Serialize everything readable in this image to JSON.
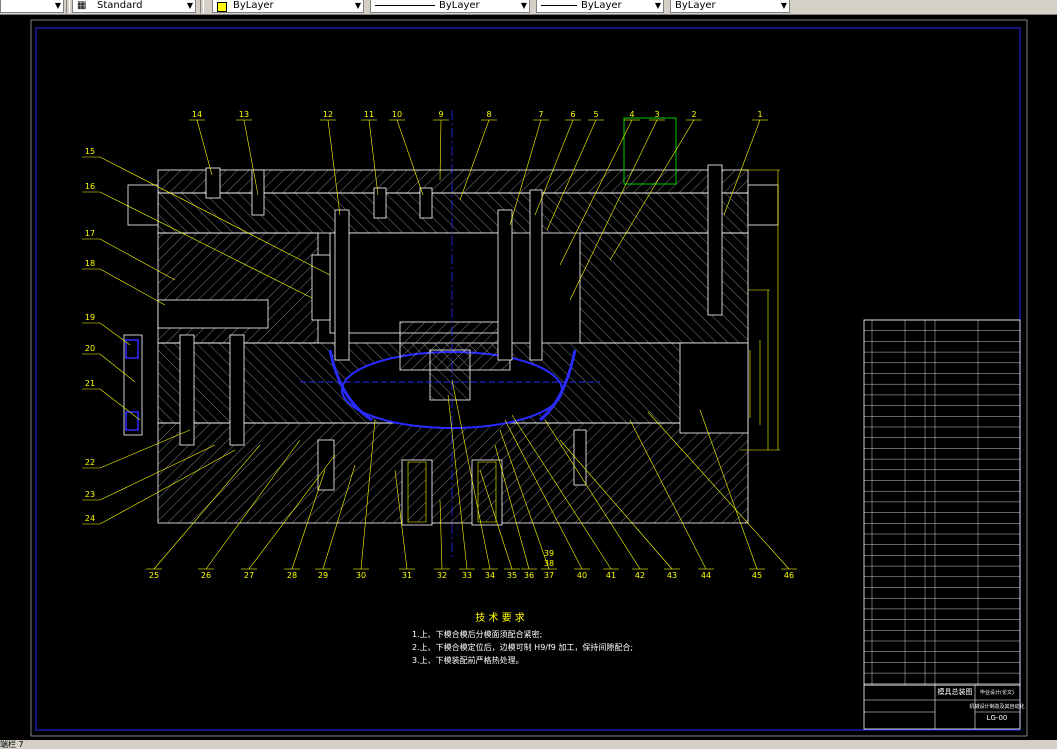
{
  "toolbar": {
    "linetype_label": "Standard",
    "color_label": "ByLayer",
    "line1_label": "ByLayer",
    "line2_label": "ByLayer",
    "line3_label": "ByLayer"
  },
  "drawing": {
    "callouts_top": [
      "14",
      "13",
      "12",
      "11",
      "10",
      "9",
      "8",
      "7",
      "6",
      "5",
      "4",
      "3",
      "2",
      "1"
    ],
    "callouts_left": [
      "15",
      "16",
      "17",
      "18",
      "19",
      "20",
      "21",
      "22",
      "23",
      "24"
    ],
    "callouts_bottom": [
      "25",
      "26",
      "27",
      "28",
      "29",
      "30",
      "31",
      "32",
      "33",
      "34",
      "35",
      "36",
      "37",
      "40",
      "41",
      "42",
      "43",
      "44",
      "45",
      "46"
    ],
    "callout_39": "39",
    "callout_38": "38",
    "tech_title": "技 术 要 求",
    "tech_lines": [
      "1.上、下模合模后分模面须配合紧密;",
      "2.上、下模合模定位后，边模可制 H9/f9 加工，保持间隙配合;",
      "3.上、下模装配前严格热处理。"
    ],
    "title_block": {
      "drawing_name": "模具总装图",
      "drawing_no": "LG-00",
      "school": "毕业设计(论文)",
      "subtitle": "机械设计制造及其自动化"
    }
  },
  "status": {
    "text": "端栏 7"
  }
}
